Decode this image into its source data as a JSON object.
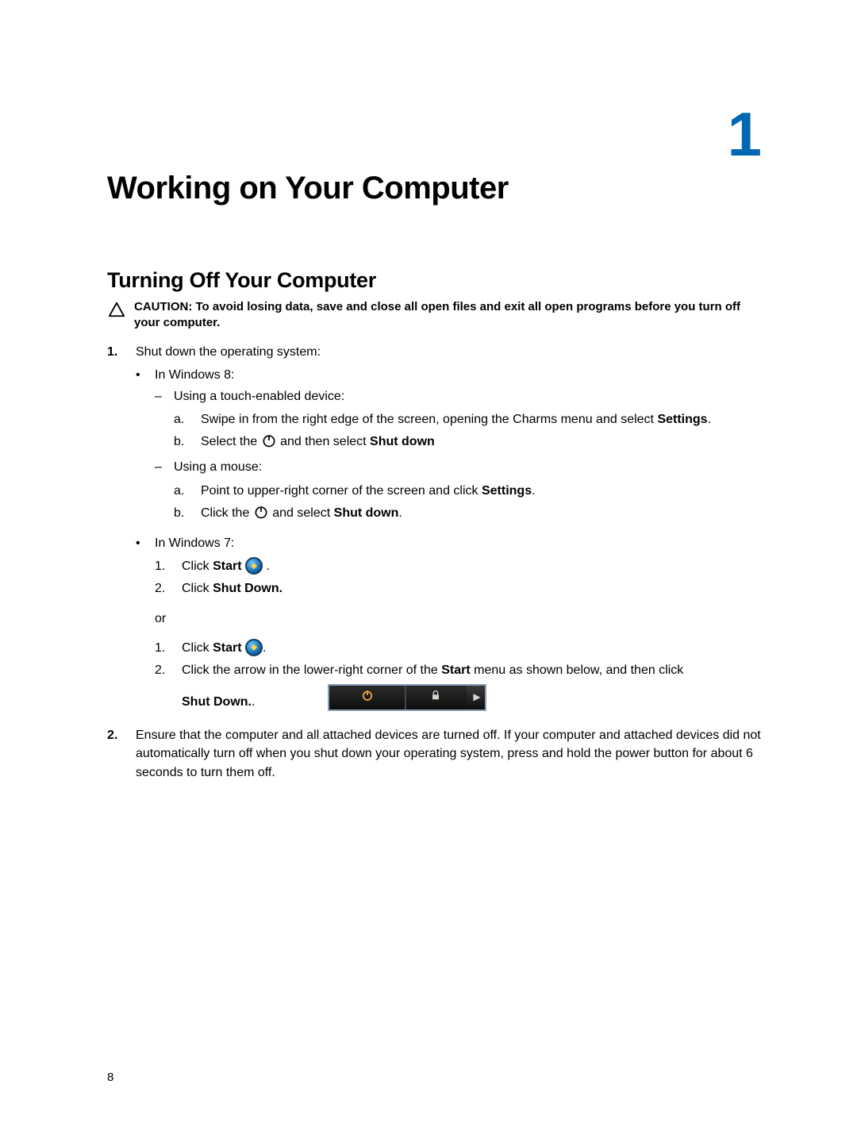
{
  "chapter_number": "1",
  "main_title": "Working on Your Computer",
  "section_title": "Turning Off Your Computer",
  "caution": {
    "label": "CAUTION:",
    "text": "To avoid losing data, save and close all open files and exit all open programs before you turn off your computer."
  },
  "steps": {
    "s1_label": "1.",
    "s1_text": "Shut down the operating system:",
    "win8_label": "In Windows 8:",
    "touch_label": "Using a touch-enabled device:",
    "touch_a_lab": "a.",
    "touch_a_pre": "Swipe in from the right edge of the screen, opening the Charms menu and select ",
    "touch_a_bold": "Settings",
    "touch_a_post": ".",
    "touch_b_lab": "b.",
    "touch_b_pre": "Select the ",
    "touch_b_mid": " and then select ",
    "touch_b_bold": "Shut down",
    "mouse_label": "Using a mouse:",
    "mouse_a_lab": "a.",
    "mouse_a_pre": "Point to upper-right corner of the screen and click ",
    "mouse_a_bold": "Settings",
    "mouse_a_post": ".",
    "mouse_b_lab": "b.",
    "mouse_b_pre": "Click the ",
    "mouse_b_mid": " and select ",
    "mouse_b_bold": "Shut down",
    "mouse_b_post": ".",
    "win7_label": "In Windows 7:",
    "w7a_1_lab": "1.",
    "w7a_1_pre": "Click ",
    "w7a_1_bold": "Start",
    "w7a_1_post": " .",
    "w7a_2_lab": "2.",
    "w7a_2_pre": "Click ",
    "w7a_2_bold": "Shut Down.",
    "or": "or",
    "w7b_1_lab": "1.",
    "w7b_1_pre": "Click ",
    "w7b_1_bold": "Start",
    "w7b_1_post": ".",
    "w7b_2_lab": "2.",
    "w7b_2_pre": "Click the arrow in the lower-right corner of the ",
    "w7b_2_bold": "Start",
    "w7b_2_post": " menu as shown below, and then click",
    "shutdown_final": "Shut Down.",
    "shutdown_final_post": ".",
    "s2_label": "2.",
    "s2_text": "Ensure that the computer and all attached devices are turned off. If your computer and attached devices did not automatically turn off when you shut down your operating system, press and hold the power button for about 6 seconds to turn them off."
  },
  "page_number": "8"
}
